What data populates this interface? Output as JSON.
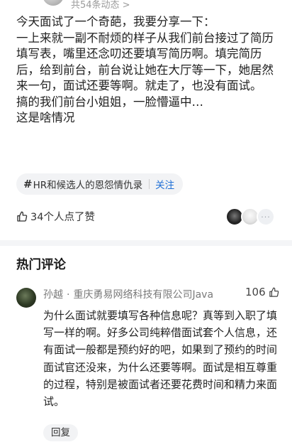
{
  "header": {
    "dynamic_count_text": "共54条动态 >"
  },
  "post": {
    "paragraphs": [
      "今天面试了一个奇葩，我要分享一下：",
      "一上来就一副不耐烦的样子从我们前台接过了简历填写表，嘴里还念叨还要填写简历啊。填完简历后，给到前台，前台说让她在大厅等一下，她居然来一句，面试还要等啊。就走了，也没有面试。",
      "搞的我们前台小姐姐，一脸懵逼中…",
      "这是啥情况"
    ],
    "topic": {
      "label": "HR和候选人的恩怨情仇录",
      "follow_label": "关注"
    },
    "likes_text": "34个人点了赞",
    "liker_more": "···"
  },
  "hot_comments": {
    "title": "热门评论",
    "comment": {
      "author": "孙越",
      "meta": "重庆勇易网络科技有限公司Java",
      "separator": "·",
      "likes": "106",
      "text": "为什么面试就要填写各种信息呢？真等到入职了填写一样的啊。好多公司纯粹借面试套个人信息，还有面试一般都是预约好的吧，如果到了预约的时间面试官还没来，为什么还要等啊。面试是相互尊重的过程，特别是被面试者还要花费时间和精力来面试。",
      "reply_label": "回复"
    }
  },
  "colors": {
    "accent": "#1f6fd6",
    "divider": "#f4f5f7",
    "pill_bg": "#f2f3f5"
  }
}
